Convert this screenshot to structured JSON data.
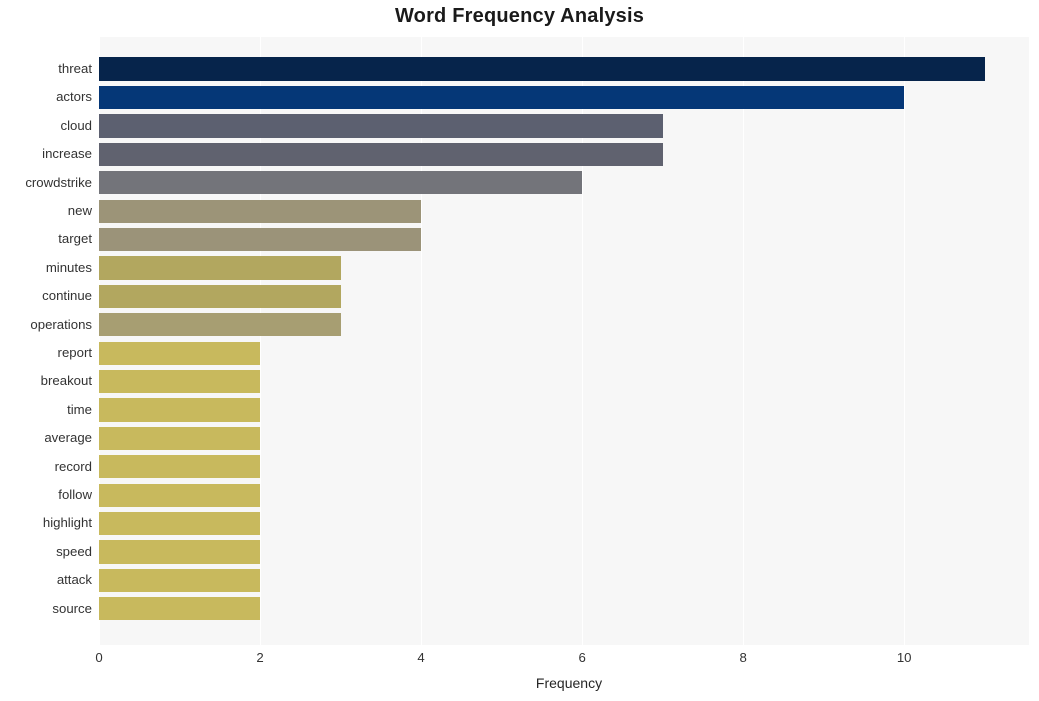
{
  "chart_data": {
    "type": "bar",
    "orientation": "horizontal",
    "title": "Word Frequency Analysis",
    "xlabel": "Frequency",
    "ylabel": "",
    "categories": [
      "threat",
      "actors",
      "cloud",
      "increase",
      "crowdstrike",
      "new",
      "target",
      "minutes",
      "continue",
      "operations",
      "report",
      "breakout",
      "time",
      "average",
      "record",
      "follow",
      "highlight",
      "speed",
      "attack",
      "source"
    ],
    "values": [
      11,
      10,
      7,
      7,
      6,
      4,
      4,
      3,
      3,
      3,
      2,
      2,
      2,
      2,
      2,
      2,
      2,
      2,
      2,
      2
    ],
    "bar_colors": [
      "#06244b",
      "#053777",
      "#5c6070",
      "#60626f",
      "#73747a",
      "#9c9478",
      "#9b9379",
      "#b2a75f",
      "#b2a75f",
      "#a79e72",
      "#c8b95d",
      "#c8b95d",
      "#c8b95d",
      "#c8b95d",
      "#c8b95d",
      "#c8b95d",
      "#c8b95d",
      "#c8b95d",
      "#c8b95d",
      "#c8b95d"
    ],
    "xticks": [
      0,
      2,
      4,
      6,
      8,
      10
    ],
    "xtick_labels": [
      "0",
      "2",
      "4",
      "6",
      "8",
      "10"
    ],
    "xlim": [
      0,
      11.55
    ],
    "grid": true,
    "grid_color": "#ffffff",
    "plot_background": "#f7f7f7",
    "figure_background": "#ffffff",
    "legend": null
  }
}
